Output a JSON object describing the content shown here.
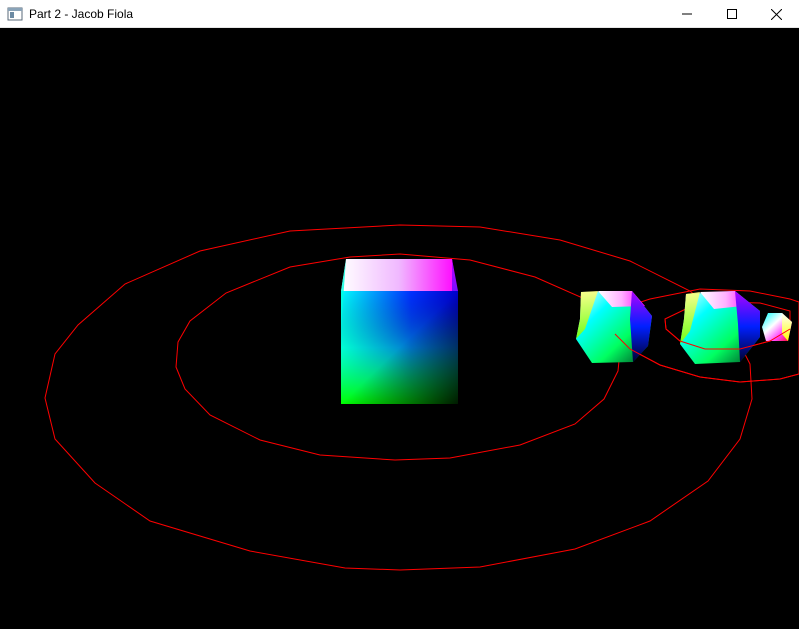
{
  "window": {
    "title": "Part 2 - Jacob Fiola",
    "icon": "app-window-icon",
    "controls": {
      "minimize_icon": "minimize-icon",
      "maximize_icon": "maximize-icon",
      "close_icon": "close-icon"
    }
  },
  "scene": {
    "background_color": "#000000",
    "orbit_color": "#ff0000",
    "objects": [
      "central-cube",
      "orbiting-cube",
      "second-orbiting-cube",
      "small-moon-cube"
    ],
    "orbits": 4
  }
}
